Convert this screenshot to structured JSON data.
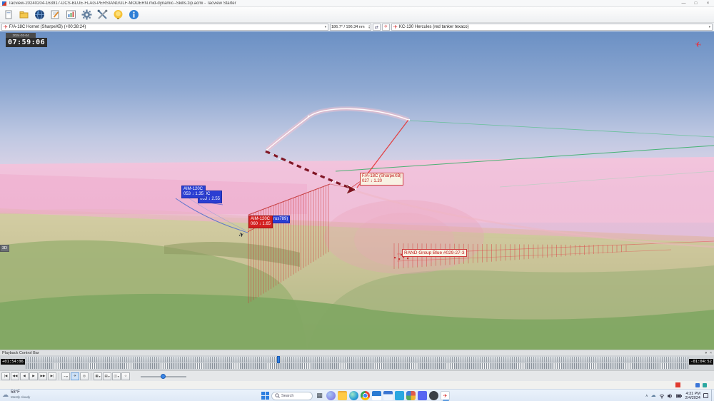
{
  "window": {
    "title": "Tacview-20240204-163917-DCS-BLUE-FLAG-PERSIANGULF-MODERN.mid-dynamic--Skills.zip.acmi - Tacview Starter",
    "minimize_glyph": "—",
    "maximize_glyph": "□",
    "close_glyph": "×"
  },
  "ui": {
    "caret": "▾",
    "spin_up": "▴",
    "spin_down": "▾"
  },
  "toolbar": {
    "icon_names": [
      "new",
      "open",
      "world-view",
      "telemetry-notes",
      "charts",
      "settings",
      "advanced-tools",
      "tips",
      "about"
    ]
  },
  "selection": {
    "primary": "F/A-18C Hornet (SharpeXB)  (+00:38:24)",
    "range": "186.7° / 196.34 nm",
    "secondary": "KC-130 Hercules (red tanker texaco)"
  },
  "viewport": {
    "date": "2024-02-04",
    "time": "07:59:06",
    "view_mode": "3D",
    "labels": {
      "aim1_name": "AIM-120C",
      "aim1_data": "053 ↓ 1.35",
      "aim1b_name": "120C",
      "aim1b_data": "063 ↓ 2.55",
      "aim2_name": "AIM-120C",
      "aim2_data": "060 ↓ 1.65",
      "partial": "rus789)",
      "hornet_name": "F/A-18C (SharpeXB)",
      "hornet_data": "027 ↓ 1.20",
      "group": "RAND Group Blue #029-27-3"
    }
  },
  "playback": {
    "bar_title": "Playback Control Bar",
    "elapsed": "+01:54:06",
    "remaining": "-01:04:52",
    "transport": [
      "|◀",
      "◀◀",
      "◀",
      "▶",
      "▶▶",
      "▶|"
    ],
    "tools": [
      "~",
      "✈",
      "◎",
      "▦",
      "▤",
      "◫",
      "☆"
    ],
    "pin_glyph": "▾",
    "close_glyph": "×"
  },
  "taskbar": {
    "weather_temp": "58°F",
    "weather_cond": "Mostly cloudy",
    "search_label": "Search",
    "tray_chevron": "∧",
    "time": "4:31 PM",
    "date": "2/4/2024"
  }
}
